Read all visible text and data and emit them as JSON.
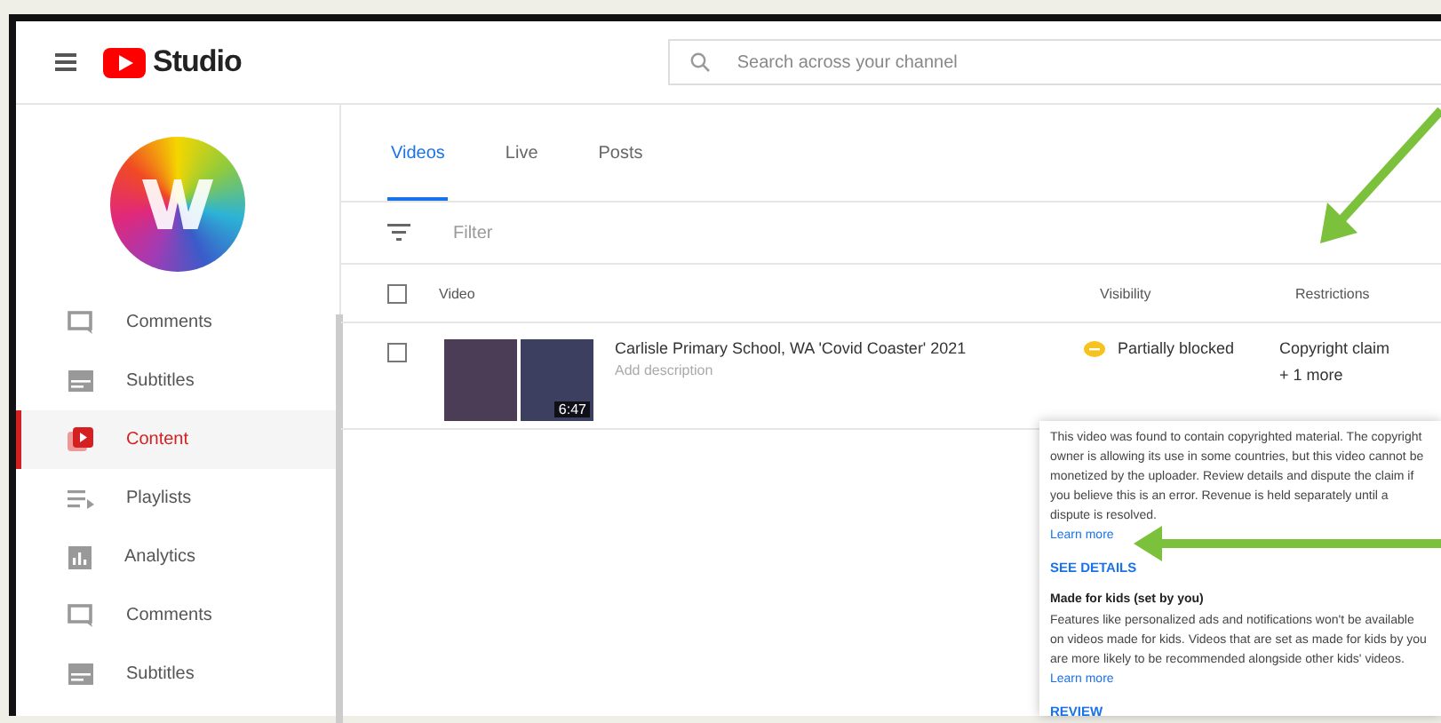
{
  "header": {
    "logo_text": "Studio",
    "search": {
      "placeholder": "Search across your channel"
    }
  },
  "sidebar": {
    "items": [
      {
        "label": "Comments",
        "kind": "comments",
        "selected": false
      },
      {
        "label": "Subtitles",
        "kind": "subtitles",
        "selected": false
      },
      {
        "label": "Content",
        "kind": "content",
        "selected": true
      },
      {
        "label": "Playlists",
        "kind": "playlists",
        "selected": false
      },
      {
        "label": "Analytics",
        "kind": "analytics",
        "selected": false
      },
      {
        "label": "Comments",
        "kind": "comments",
        "selected": false
      },
      {
        "label": "Subtitles",
        "kind": "subtitles",
        "selected": false
      }
    ]
  },
  "tabs": [
    {
      "label": "Videos",
      "selected": true
    },
    {
      "label": "Live",
      "selected": false
    },
    {
      "label": "Posts",
      "selected": false
    }
  ],
  "filter": {
    "placeholder": "Filter"
  },
  "table": {
    "select_all_checked": false,
    "columns": [
      "Video",
      "Visibility",
      "Restrictions"
    ],
    "rows": [
      {
        "checked": false,
        "title": "Carlisle Primary School, WA 'Covid Coaster' 2021",
        "description": "Add description",
        "duration": "6:47",
        "visibility": "Partially blocked",
        "restrictions": [
          "Copyright claim",
          "+ 1 more"
        ]
      }
    ]
  },
  "popup": {
    "paragraph": "This video was found to contain copyrighted material. The copyright owner is allowing its use in some countries, but this video cannot be monetized by the uploader. Review details and dispute the claim if you believe this is an error. Revenue is held separately until a dispute is resolved.",
    "learn_more": "Learn more",
    "see_details": "SEE DETAILS",
    "kids_heading": "Made for kids (set by you)",
    "kids_paragraph": "Features like personalized ads and notifications won't be available on videos made for kids. Videos that are set as made for kids by you are more likely to be recommended alongside other kids' videos.",
    "kids_link": "Learn more",
    "review": "REVIEW"
  }
}
